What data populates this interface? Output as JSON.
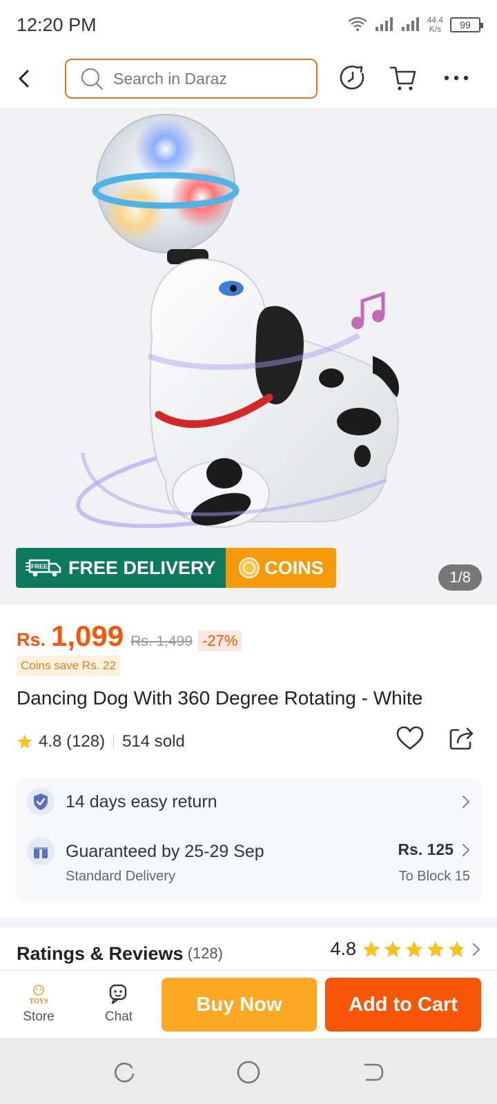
{
  "status_bar": {
    "time": "12:20 PM",
    "net_speed_value": "44.4",
    "net_speed_unit": "K/s",
    "battery": "99"
  },
  "header": {
    "search_placeholder": "Search in Daraz"
  },
  "gallery": {
    "free_delivery_badge": "FREE",
    "free_delivery_label": "FREE DELIVERY",
    "coins_label": "COINS",
    "image_counter": "1/8"
  },
  "product": {
    "currency": "Rs.",
    "price": "1,099",
    "old_price": "Rs. 1,499",
    "discount": "-27%",
    "coins_save": "Coins save Rs. 22",
    "title": "Dancing Dog With 360 Degree Rotating - White",
    "rating": "4.8",
    "rating_count": "(128)",
    "sold": "514 sold"
  },
  "service": {
    "return_label": "14 days easy return",
    "delivery_guarantee": "Guaranteed by 25-29 Sep",
    "delivery_type": "Standard Delivery",
    "delivery_fee": "Rs. 125",
    "delivery_to": "To Block 15"
  },
  "ratings": {
    "title": "Ratings & Reviews",
    "count": "(128)",
    "score": "4.8",
    "stars_value": 4.8
  },
  "bottom_bar": {
    "store_logo_text": "TOYS",
    "store_label": "Store",
    "chat_label": "Chat",
    "buy_now": "Buy Now",
    "add_to_cart": "Add to Cart"
  },
  "colors": {
    "brand_orange": "#f85606",
    "buy_now_yellow": "#fca823",
    "free_delivery_green": "#0d7a5e",
    "coins_orange": "#f59a0b",
    "star_yellow": "#f8c21c"
  }
}
